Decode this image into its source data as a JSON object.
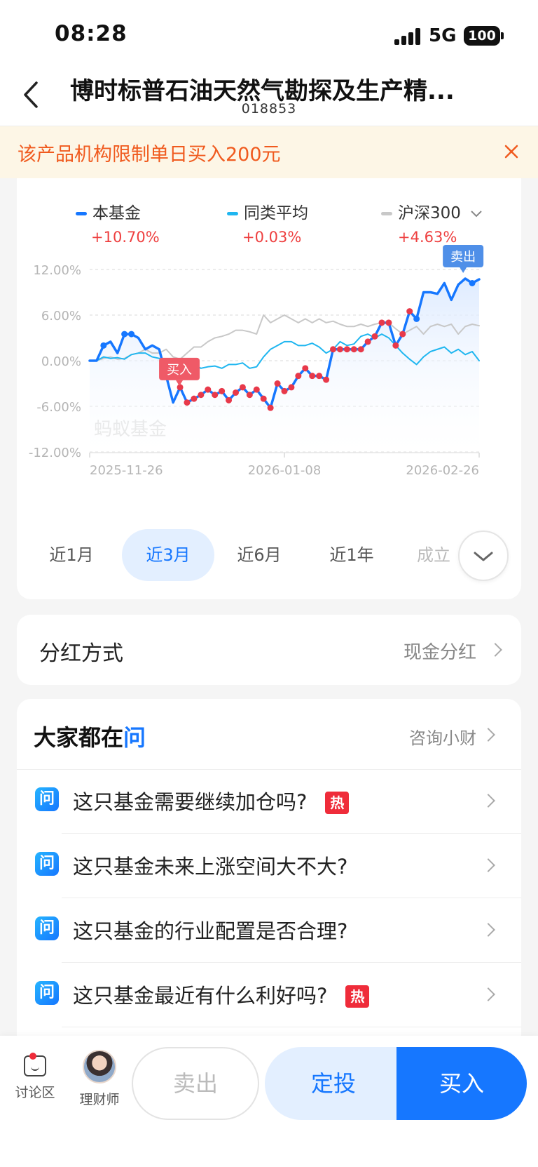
{
  "status": {
    "time": "08:28",
    "network": "5G",
    "battery": "100"
  },
  "header": {
    "title": "博时标普石油天然气勘探及生产精...",
    "code": "018853"
  },
  "notice": {
    "text": "该产品机构限制单日买入200元"
  },
  "legend": [
    {
      "name": "本基金",
      "value": "+10.70%",
      "color": "#1677ff"
    },
    {
      "name": "同类平均",
      "value": "+0.03%",
      "color": "#1fb6f0"
    },
    {
      "name": "沪深300",
      "value": "+4.63%",
      "color": "#c8c8c8"
    }
  ],
  "chart_data": {
    "type": "line",
    "watermark": "蚂蚁基金",
    "y_ticks": [
      "12.00%",
      "6.00%",
      "0.00%",
      "-6.00%",
      "-12.00%"
    ],
    "ylim": [
      -12,
      12
    ],
    "x_ticks": [
      "2025-11-26",
      "2026-01-08",
      "2026-02-26"
    ],
    "markers": {
      "buy": "买入",
      "sell": "卖出"
    },
    "series": [
      {
        "name": "本基金",
        "color": "#1677ff",
        "values": [
          0.0,
          0.0,
          2.0,
          2.5,
          1.0,
          3.5,
          3.5,
          3.0,
          1.5,
          2.0,
          1.5,
          -2.0,
          -5.5,
          -3.5,
          -5.5,
          -5.0,
          -4.5,
          -3.8,
          -4.5,
          -4.0,
          -5.2,
          -4.2,
          -3.5,
          -4.5,
          -3.8,
          -5.0,
          -6.2,
          -3.0,
          -4.0,
          -3.5,
          -2.0,
          -1.0,
          -2.0,
          -2.0,
          -2.5,
          1.5,
          1.5,
          1.5,
          1.5,
          1.5,
          2.5,
          3.2,
          5.0,
          5.0,
          2.0,
          3.5,
          6.5,
          5.5,
          9.0,
          9.0,
          8.8,
          10.2,
          8.0,
          10.0,
          10.8,
          10.2,
          10.7
        ]
      },
      {
        "name": "同类平均",
        "color": "#1fb6f0",
        "values": [
          0.0,
          0.0,
          0.5,
          0.3,
          0.4,
          0.2,
          0.8,
          1.0,
          1.0,
          0.5,
          0.3,
          -0.5,
          -1.5,
          -1.0,
          -0.5,
          -0.5,
          -1.0,
          -0.8,
          -0.7,
          -1.0,
          -0.5,
          -0.5,
          -0.3,
          -1.0,
          -0.8,
          0.5,
          1.5,
          2.0,
          2.5,
          2.5,
          2.0,
          2.0,
          2.3,
          1.8,
          1.0,
          1.5,
          2.5,
          2.0,
          2.2,
          3.2,
          3.5,
          3.0,
          3.5,
          3.0,
          2.0,
          1.0,
          0.2,
          -0.5,
          0.5,
          1.2,
          1.5,
          1.8,
          1.0,
          1.5,
          0.8,
          1.2,
          0.0
        ]
      },
      {
        "name": "沪深300",
        "color": "#c8c8c8",
        "values": [
          0.0,
          0.0,
          0.3,
          0.5,
          0.2,
          0.3,
          0.8,
          1.0,
          1.5,
          1.0,
          1.0,
          1.5,
          0.5,
          0.2,
          1.0,
          1.8,
          1.8,
          2.5,
          3.0,
          3.2,
          3.5,
          4.0,
          4.0,
          3.8,
          3.5,
          6.0,
          5.0,
          5.5,
          6.0,
          5.5,
          5.0,
          5.5,
          5.0,
          5.5,
          5.0,
          5.2,
          4.8,
          4.5,
          4.5,
          4.8,
          4.5,
          4.8,
          5.0,
          5.0,
          4.2,
          3.5,
          4.0,
          4.5,
          3.5,
          4.5,
          4.8,
          4.5,
          4.8,
          3.5,
          4.5,
          4.8,
          4.6
        ]
      }
    ]
  },
  "range_tabs": [
    "近1月",
    "近3月",
    "近6月",
    "近1年",
    "成立"
  ],
  "range_active": 1,
  "dividend": {
    "label": "分红方式",
    "value": "现金分红"
  },
  "qa": {
    "title_main": "大家都在",
    "title_accent": "问",
    "link": "咨询小财",
    "icon_text": "问",
    "hot": "热",
    "questions": [
      {
        "text": "这只基金需要继续加仓吗?",
        "hot": true
      },
      {
        "text": "这只基金未来上涨空间大不大?",
        "hot": false
      },
      {
        "text": "这只基金的行业配置是否合理?",
        "hot": false
      },
      {
        "text": "这只基金最近有什么利好吗?",
        "hot": true
      }
    ]
  },
  "bottom": {
    "discuss": "讨论区",
    "advisor": "理财师",
    "sell": "卖出",
    "fixed": "定投",
    "buy": "买入"
  }
}
